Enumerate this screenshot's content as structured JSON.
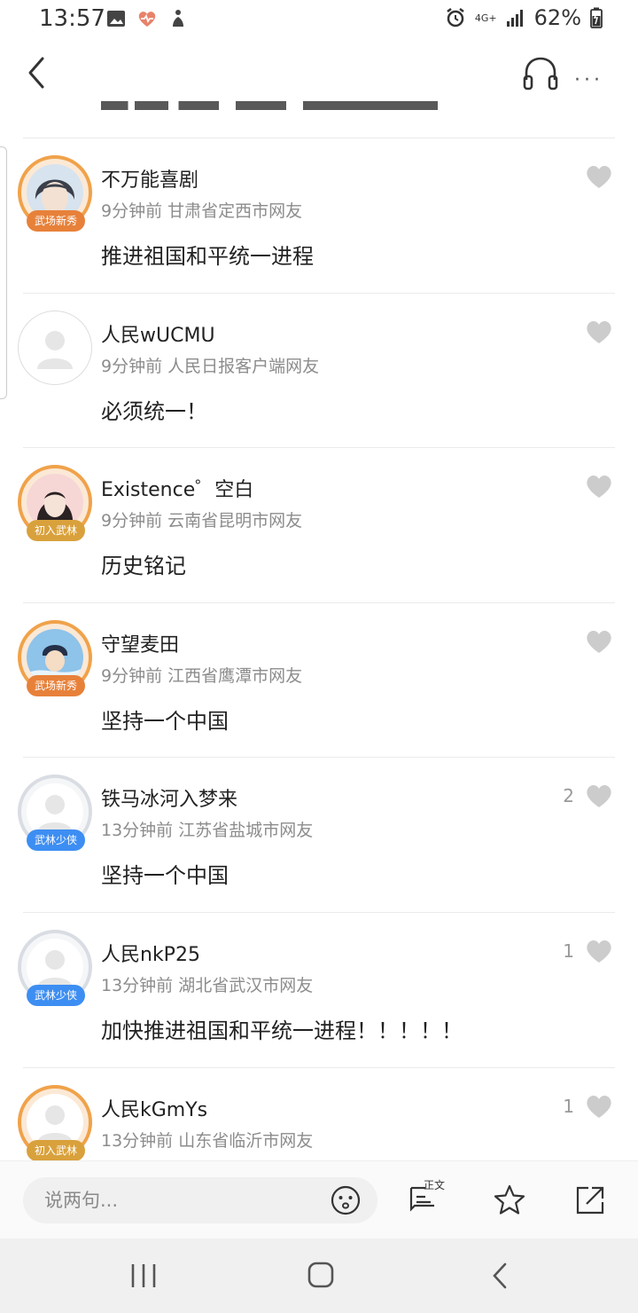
{
  "status_bar": {
    "time": "13:57",
    "network": "4G+",
    "battery": "62%"
  },
  "toolbar": {
    "back_icon": "back-arrow-icon",
    "listen_icon": "headphones-icon",
    "more_label": "···"
  },
  "comments": [
    {
      "name": "不万能喜剧",
      "time": "9分钟前",
      "location": "甘肃省定西市网友",
      "text": "推进祖国和平统一进程",
      "badge": "武场新秀",
      "likes": ""
    },
    {
      "name": "人民wUCMU",
      "time": "9分钟前",
      "location": "人民日报客户端网友",
      "text": "必须统一！",
      "badge": "",
      "likes": ""
    },
    {
      "name": "Existence゜空白",
      "time": "9分钟前",
      "location": "云南省昆明市网友",
      "text": "历史铭记",
      "badge": "初入武林",
      "likes": ""
    },
    {
      "name": "守望麦田",
      "time": "9分钟前",
      "location": "江西省鹰潭市网友",
      "text": "坚持一个中国",
      "badge": "武场新秀",
      "likes": ""
    },
    {
      "name": "铁马冰河入梦来",
      "time": "13分钟前",
      "location": "江苏省盐城市网友",
      "text": "坚持一个中国",
      "badge": "武林少侠",
      "likes": "2"
    },
    {
      "name": "人民nkP25",
      "time": "13分钟前",
      "location": "湖北省武汉市网友",
      "text": "加快推进祖国和平统一进程！！！！！",
      "badge": "武林少侠",
      "likes": "1"
    },
    {
      "name": "人民kGmYs",
      "time": "13分钟前",
      "location": "山东省临沂市网友",
      "text": "",
      "badge": "初入武林",
      "likes": "1"
    }
  ],
  "bottom_bar": {
    "input_placeholder": "说两句...",
    "article_label": "正文",
    "icons": [
      "emoji-icon",
      "article-icon",
      "star-icon",
      "share-icon"
    ]
  },
  "colors": {
    "badge_orange": "#e7813a",
    "badge_gold": "#d9a13c",
    "badge_blue": "#3d8ef2",
    "heart_gray": "#cccccc"
  }
}
